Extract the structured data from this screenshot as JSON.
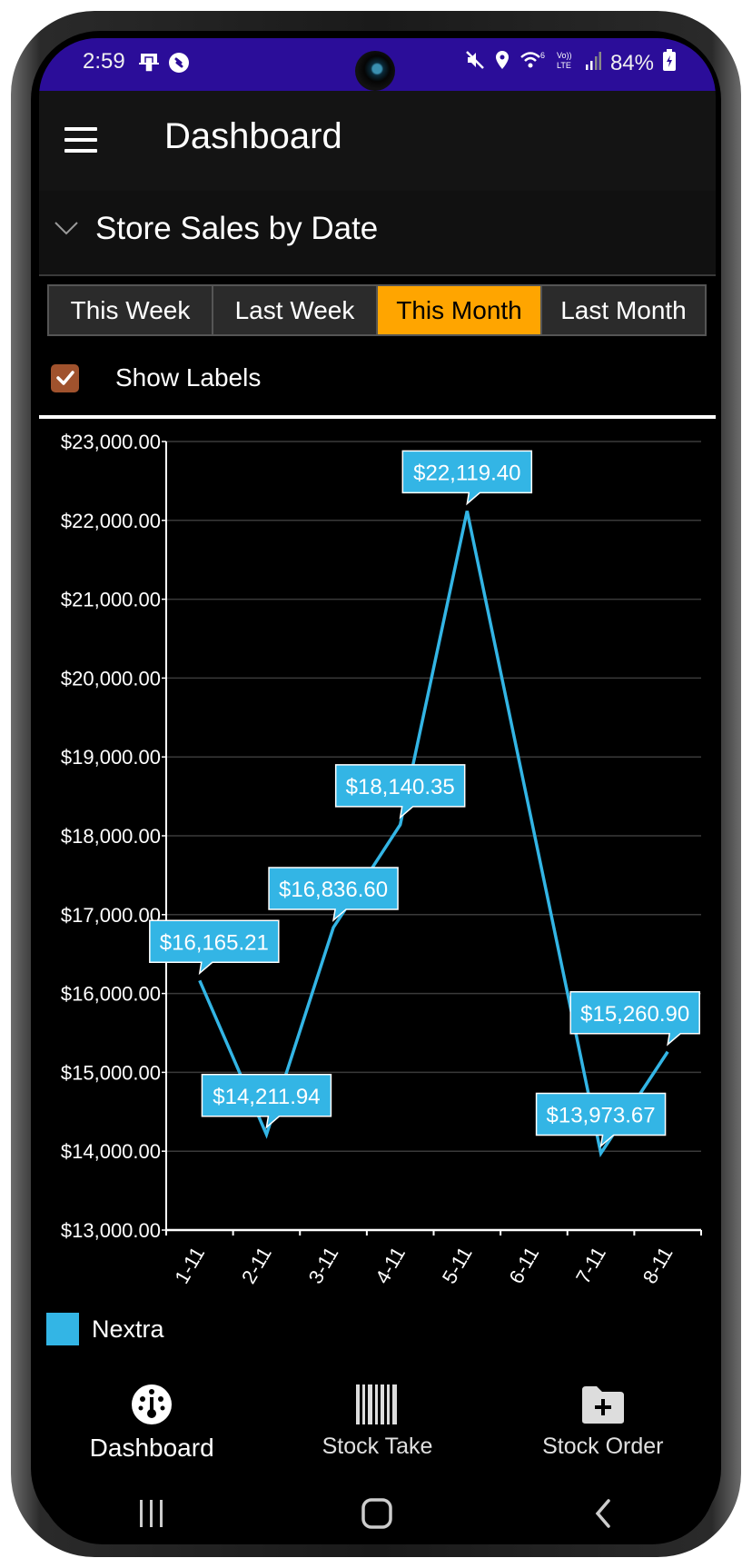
{
  "status_bar": {
    "time": "2:59",
    "battery": "84%",
    "left_icons": [
      "cast-icon",
      "shazam-icon"
    ],
    "right_icons": [
      "mute-icon",
      "location-icon",
      "wifi-icon",
      "volte-icon",
      "signal-icon",
      "battery-charging-icon"
    ]
  },
  "app_bar": {
    "menu_icon": "hamburger-menu-icon",
    "title": "Dashboard"
  },
  "section": {
    "chevron_icon": "chevron-down-icon",
    "title": "Store Sales by Date"
  },
  "tabs": [
    {
      "label": "This Week",
      "active": false
    },
    {
      "label": "Last Week",
      "active": false
    },
    {
      "label": "This Month",
      "active": true
    },
    {
      "label": "Last Month",
      "active": false
    }
  ],
  "show_labels": {
    "label": "Show Labels",
    "checked": true
  },
  "colors": {
    "status_bar": "#2b0d99",
    "accent_tab": "#ffa500",
    "checkbox": "#a0522d",
    "series": "#33b5e5"
  },
  "chart_data": {
    "type": "line",
    "title": "Store Sales by Date",
    "xlabel": "",
    "ylabel": "",
    "categories": [
      "1-11",
      "2-11",
      "3-11",
      "4-11",
      "5-11",
      "6-11",
      "7-11",
      "8-11"
    ],
    "series": [
      {
        "name": "Nextra",
        "color": "#33b5e5",
        "values": [
          16165.21,
          14211.94,
          16836.6,
          18140.35,
          22119.4,
          null,
          13973.67,
          15260.9
        ],
        "labels": [
          "$16,165.21",
          "$14,211.94",
          "$16,836.60",
          "$18,140.35",
          "$22,119.40",
          null,
          "$13,973.67",
          "$15,260.90"
        ]
      }
    ],
    "ylim": [
      13000,
      23000
    ],
    "yticks": [
      13000,
      14000,
      15000,
      16000,
      17000,
      18000,
      19000,
      20000,
      21000,
      22000,
      23000
    ],
    "ytick_labels": [
      "$13,000.00",
      "$14,000.00",
      "$15,000.00",
      "$16,000.00",
      "$17,000.00",
      "$18,000.00",
      "$19,000.00",
      "$20,000.00",
      "$21,000.00",
      "$22,000.00",
      "$23,000.00"
    ],
    "grid": true,
    "show_data_labels": true,
    "legend": {
      "position": "bottom-left",
      "entries": [
        "Nextra"
      ]
    }
  },
  "bottom_nav": [
    {
      "label": "Dashboard",
      "icon": "dashboard-gauge-icon",
      "active": true
    },
    {
      "label": "Stock Take",
      "icon": "barcode-icon",
      "active": false
    },
    {
      "label": "Stock Order",
      "icon": "folder-add-icon",
      "active": false
    }
  ],
  "system_nav": [
    {
      "name": "recents-button",
      "icon": "recents-icon"
    },
    {
      "name": "home-button",
      "icon": "home-icon"
    },
    {
      "name": "back-button",
      "icon": "back-icon"
    }
  ]
}
